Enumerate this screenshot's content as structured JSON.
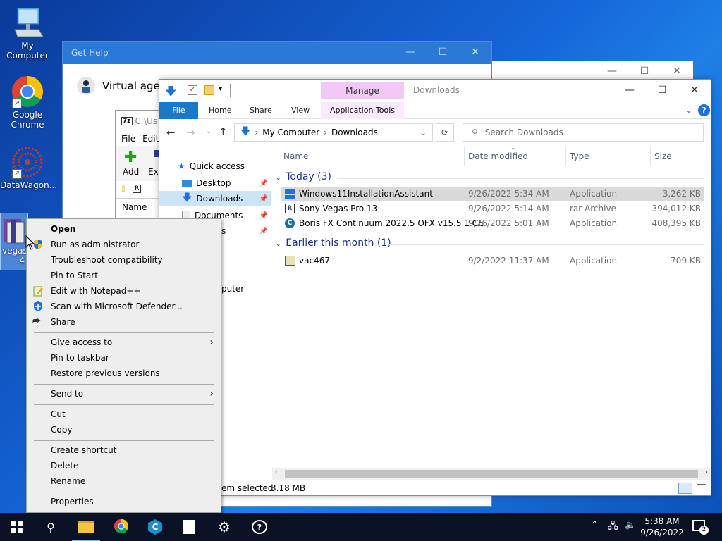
{
  "desktop": {
    "icons": [
      {
        "label": "My Computer"
      },
      {
        "label": "Google Chrome"
      },
      {
        "label": "DataWagon..."
      },
      {
        "label": "vegasp",
        "label2": "4"
      }
    ]
  },
  "gethelp": {
    "title": "Get Help",
    "agent_label": "Virtual agent"
  },
  "sevenzip": {
    "path": "C:\\Us",
    "menu_file": "File",
    "menu_edit": "Edit",
    "add_label": "Add",
    "extract_label": "Ext",
    "col_name": "Name"
  },
  "explorer": {
    "title": "Downloads",
    "manage_tab": "Manage",
    "ribbon_tabs": [
      "File",
      "Home",
      "Share",
      "View"
    ],
    "app_tools_tab": "Application Tools",
    "breadcrumb": [
      "My Computer",
      "Downloads"
    ],
    "search_placeholder": "Search Downloads",
    "nav": {
      "quick_access": "Quick access",
      "desktop": "Desktop",
      "downloads": "Downloads",
      "documents": "Documents",
      "item4_partial": "s",
      "computer_partial": "puter"
    },
    "columns": {
      "name": "Name",
      "date": "Date modified",
      "type": "Type",
      "size": "Size"
    },
    "groups": [
      {
        "header": "Today (3)",
        "files": [
          {
            "name": "Windows11InstallationAssistant",
            "date": "9/26/2022 5:34 AM",
            "type": "Application",
            "size": "3,262 KB",
            "icon": "windows-logo-icon",
            "selected": true
          },
          {
            "name": "Sony Vegas Pro 13",
            "date": "9/26/2022 5:14 AM",
            "type": "rar Archive",
            "size": "394,012 KB",
            "icon": "rar-archive-icon"
          },
          {
            "name": "Boris FX Continuum 2022.5 OFX v15.5.1 CE",
            "date": "9/26/2022 5:01 AM",
            "type": "Application",
            "size": "408,395 KB",
            "icon": "boris-fx-icon"
          }
        ]
      },
      {
        "header": "Earlier this month (1)",
        "files": [
          {
            "name": "vac467",
            "date": "9/2/2022 11:37 AM",
            "type": "Application",
            "size": "709 KB",
            "icon": "installer-icon"
          }
        ]
      }
    ],
    "status_text": "em selected",
    "status_size": "3.18 MB"
  },
  "context_menu": {
    "items": [
      {
        "label": "Open",
        "bold": true
      },
      {
        "label": "Run as administrator",
        "icon": "shield-icon"
      },
      {
        "label": "Troubleshoot compatibility"
      },
      {
        "label": "Pin to Start"
      },
      {
        "label": "Edit with Notepad++",
        "icon": "notepadpp-icon"
      },
      {
        "label": "Scan with Microsoft Defender...",
        "icon": "defender-icon"
      },
      {
        "label": "Share",
        "icon": "share-icon"
      },
      {
        "label": "Give access to",
        "submenu": true
      },
      {
        "label": "Pin to taskbar"
      },
      {
        "label": "Restore previous versions"
      },
      {
        "label": "Send to",
        "submenu": true
      },
      {
        "label": "Cut"
      },
      {
        "label": "Copy"
      },
      {
        "label": "Create shortcut"
      },
      {
        "label": "Delete"
      },
      {
        "label": "Rename"
      },
      {
        "label": "Properties"
      }
    ]
  },
  "taskbar": {
    "time": "5:38 AM",
    "date": "9/26/2022",
    "notification_count": "2"
  }
}
